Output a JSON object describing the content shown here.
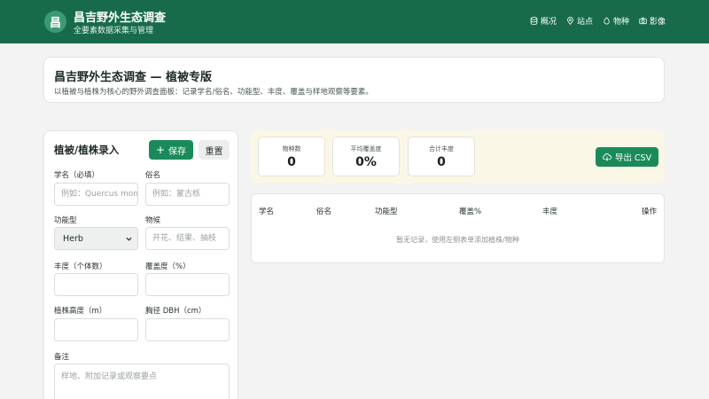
{
  "header": {
    "logo_char": "昌",
    "title": "昌吉野外生态调查",
    "subtitle": "全要素数据采集与管理",
    "nav": [
      {
        "label": "概况",
        "icon": "database-icon"
      },
      {
        "label": "站点",
        "icon": "map-pin-icon"
      },
      {
        "label": "物种",
        "icon": "leaf-icon"
      },
      {
        "label": "影像",
        "icon": "camera-icon"
      }
    ]
  },
  "hero": {
    "title": "昌吉野外生态调查 — 植被专版",
    "description": "以植被与植株为核心的野外调查面板：记录学名/俗名、功能型、丰度、覆盖与样地观察等要素。"
  },
  "form": {
    "title": "植被/植株录入",
    "save_label": "保存",
    "reset_label": "重置",
    "fields": {
      "sci_name": {
        "label": "学名（必填）",
        "placeholder": "例如：Quercus mongolica"
      },
      "common_name": {
        "label": "俗名",
        "placeholder": "例如：蒙古栎"
      },
      "functional_type": {
        "label": "功能型",
        "value": "Herb"
      },
      "phenology": {
        "label": "物候",
        "placeholder": "开花、结果、抽枝"
      },
      "abundance": {
        "label": "丰度（个体数）",
        "placeholder": ""
      },
      "coverage": {
        "label": "覆盖度（%）",
        "placeholder": ""
      },
      "height": {
        "label": "植株高度（m）",
        "placeholder": ""
      },
      "dbh": {
        "label": "胸径 DBH（cm）",
        "placeholder": ""
      },
      "notes": {
        "label": "备注",
        "placeholder": "样地、附加记录或观察要点"
      }
    }
  },
  "stats": [
    {
      "label": "物种数",
      "value": "0"
    },
    {
      "label": "平均覆盖度",
      "value": "0%"
    },
    {
      "label": "合计丰度",
      "value": "0"
    }
  ],
  "export_label": "导出 CSV",
  "table": {
    "columns": [
      "学名",
      "俗名",
      "功能型",
      "覆盖%",
      "丰度",
      "操作"
    ],
    "empty_message": "暂无记录，使用左侧表单添加植株/物种"
  },
  "colors": {
    "header_bg": "#176b4a",
    "accent": "#1b8a5a",
    "stats_band_bg": "#fbf7e6"
  }
}
